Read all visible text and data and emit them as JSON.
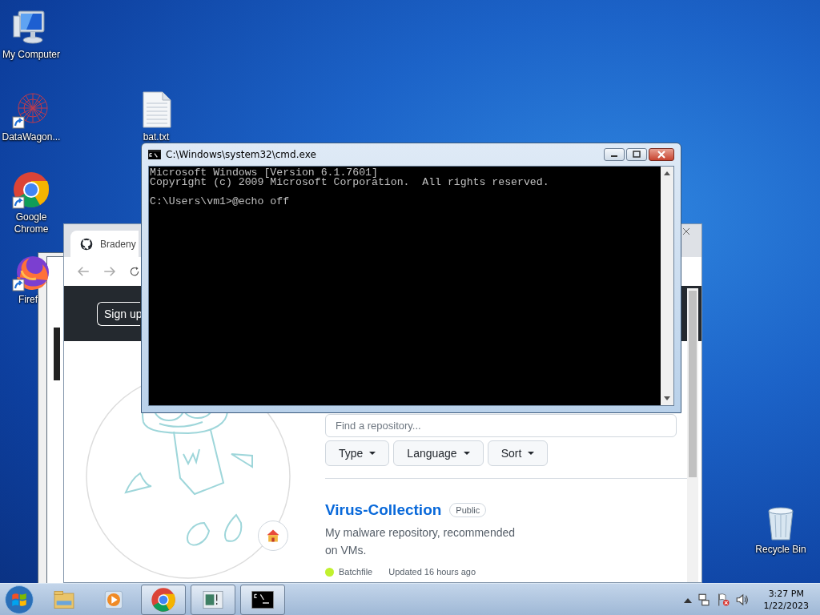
{
  "desktop_icons": [
    {
      "label": "My Computer",
      "kind": "computer",
      "shortcut": false
    },
    {
      "label": "DataWagon...",
      "kind": "network",
      "shortcut": true
    },
    {
      "label": "bat.txt",
      "kind": "textfile",
      "shortcut": false
    },
    {
      "label": "Google Chrome",
      "kind": "chrome",
      "shortcut": true
    },
    {
      "label": "Firef",
      "kind": "firefox",
      "shortcut": true
    },
    {
      "label": "Recycle Bin",
      "kind": "bin",
      "shortcut": false
    }
  ],
  "browser": {
    "tab_title": "Bradeny",
    "sign_up": "Sign up",
    "search": {
      "placeholder": "Find a repository..."
    },
    "filters": [
      "Type",
      "Language",
      "Sort"
    ],
    "repo": {
      "name": "Virus-Collection",
      "visibility": "Public",
      "description": "My malware repository, recommended on VMs.",
      "language": "Batchfile",
      "updated": "Updated 16 hours ago"
    }
  },
  "cmd": {
    "title": "C:\\Windows\\system32\\cmd.exe",
    "lines": [
      {
        "text": "Microsoft Windows [Version 6.1.7601]",
        "kind": "output"
      },
      {
        "text": "Copyright (c) 2009 Microsoft Corporation.  All rights reserved.",
        "kind": "output"
      },
      {
        "text": "C:\\Users\\vm1>@echo off",
        "kind": "prompt"
      }
    ]
  },
  "taskbar": {
    "items": [
      {
        "kind": "explorer",
        "running": false
      },
      {
        "kind": "media",
        "running": false
      },
      {
        "kind": "chrome",
        "running": true
      },
      {
        "kind": "window",
        "running": true
      },
      {
        "kind": "console",
        "running": true
      }
    ],
    "time": "3:27 PM",
    "date": "1/22/2023"
  }
}
